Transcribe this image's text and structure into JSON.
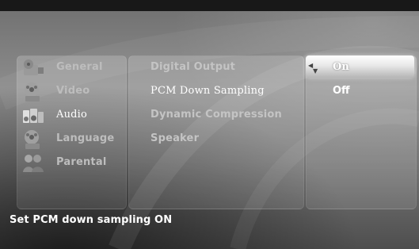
{
  "menu": {
    "items": [
      {
        "label": "General",
        "icon": "film-reel-icon"
      },
      {
        "label": "Video",
        "icon": "film-reel-icon"
      },
      {
        "label": "Audio",
        "icon": "speaker-icon"
      },
      {
        "label": "Language",
        "icon": "film-reel-icon"
      },
      {
        "label": "Parental",
        "icon": "family-icon"
      }
    ],
    "selected": "Audio"
  },
  "settings": {
    "items": [
      "Digital Output",
      "PCM Down Sampling",
      "Dynamic Compression",
      "Speaker"
    ],
    "selected": "PCM Down Sampling"
  },
  "options": {
    "items": [
      "On",
      "Off"
    ],
    "selected": "On"
  },
  "status": {
    "text": "Set PCM down sampling ON"
  },
  "colors": {
    "text_primary": "#ffffff",
    "text_muted": "#bdbdbd",
    "highlight": "#f2f2f2"
  }
}
